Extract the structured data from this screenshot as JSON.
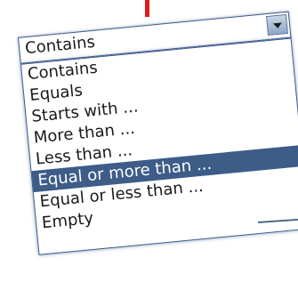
{
  "combo": {
    "value": "Contains"
  },
  "dropdown": {
    "options": [
      {
        "label": "Contains"
      },
      {
        "label": "Equals"
      },
      {
        "label": "Starts with ..."
      },
      {
        "label": "More than ..."
      },
      {
        "label": "Less than ..."
      },
      {
        "label": "Equal or more than ..."
      },
      {
        "label": "Equal or less than ..."
      },
      {
        "label": "Empty"
      }
    ],
    "selected_option": "Equal or more than ..."
  },
  "colors": {
    "highlight": "#3d5c88",
    "border": "#3d5a8a",
    "accent_mark": "#e01818",
    "pointer_line": "#4a6d86"
  },
  "icons": {
    "dropdown_arrow": "chevron-down-icon"
  }
}
